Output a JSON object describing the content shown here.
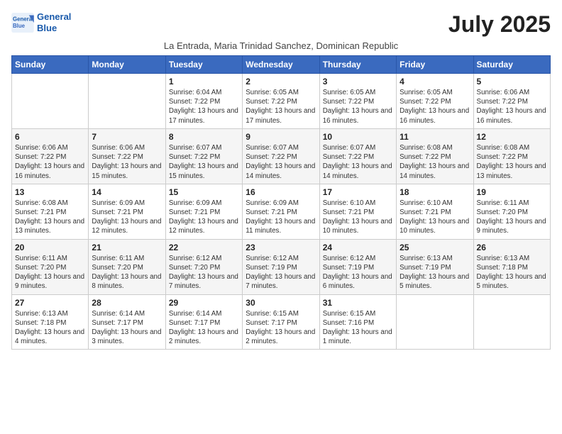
{
  "header": {
    "logo_line1": "General",
    "logo_line2": "Blue",
    "month_year": "July 2025",
    "location": "La Entrada, Maria Trinidad Sanchez, Dominican Republic"
  },
  "weekdays": [
    "Sunday",
    "Monday",
    "Tuesday",
    "Wednesday",
    "Thursday",
    "Friday",
    "Saturday"
  ],
  "weeks": [
    [
      {
        "day": "",
        "info": ""
      },
      {
        "day": "",
        "info": ""
      },
      {
        "day": "1",
        "info": "Sunrise: 6:04 AM\nSunset: 7:22 PM\nDaylight: 13 hours and 17 minutes."
      },
      {
        "day": "2",
        "info": "Sunrise: 6:05 AM\nSunset: 7:22 PM\nDaylight: 13 hours and 17 minutes."
      },
      {
        "day": "3",
        "info": "Sunrise: 6:05 AM\nSunset: 7:22 PM\nDaylight: 13 hours and 16 minutes."
      },
      {
        "day": "4",
        "info": "Sunrise: 6:05 AM\nSunset: 7:22 PM\nDaylight: 13 hours and 16 minutes."
      },
      {
        "day": "5",
        "info": "Sunrise: 6:06 AM\nSunset: 7:22 PM\nDaylight: 13 hours and 16 minutes."
      }
    ],
    [
      {
        "day": "6",
        "info": "Sunrise: 6:06 AM\nSunset: 7:22 PM\nDaylight: 13 hours and 16 minutes."
      },
      {
        "day": "7",
        "info": "Sunrise: 6:06 AM\nSunset: 7:22 PM\nDaylight: 13 hours and 15 minutes."
      },
      {
        "day": "8",
        "info": "Sunrise: 6:07 AM\nSunset: 7:22 PM\nDaylight: 13 hours and 15 minutes."
      },
      {
        "day": "9",
        "info": "Sunrise: 6:07 AM\nSunset: 7:22 PM\nDaylight: 13 hours and 14 minutes."
      },
      {
        "day": "10",
        "info": "Sunrise: 6:07 AM\nSunset: 7:22 PM\nDaylight: 13 hours and 14 minutes."
      },
      {
        "day": "11",
        "info": "Sunrise: 6:08 AM\nSunset: 7:22 PM\nDaylight: 13 hours and 14 minutes."
      },
      {
        "day": "12",
        "info": "Sunrise: 6:08 AM\nSunset: 7:22 PM\nDaylight: 13 hours and 13 minutes."
      }
    ],
    [
      {
        "day": "13",
        "info": "Sunrise: 6:08 AM\nSunset: 7:21 PM\nDaylight: 13 hours and 13 minutes."
      },
      {
        "day": "14",
        "info": "Sunrise: 6:09 AM\nSunset: 7:21 PM\nDaylight: 13 hours and 12 minutes."
      },
      {
        "day": "15",
        "info": "Sunrise: 6:09 AM\nSunset: 7:21 PM\nDaylight: 13 hours and 12 minutes."
      },
      {
        "day": "16",
        "info": "Sunrise: 6:09 AM\nSunset: 7:21 PM\nDaylight: 13 hours and 11 minutes."
      },
      {
        "day": "17",
        "info": "Sunrise: 6:10 AM\nSunset: 7:21 PM\nDaylight: 13 hours and 10 minutes."
      },
      {
        "day": "18",
        "info": "Sunrise: 6:10 AM\nSunset: 7:21 PM\nDaylight: 13 hours and 10 minutes."
      },
      {
        "day": "19",
        "info": "Sunrise: 6:11 AM\nSunset: 7:20 PM\nDaylight: 13 hours and 9 minutes."
      }
    ],
    [
      {
        "day": "20",
        "info": "Sunrise: 6:11 AM\nSunset: 7:20 PM\nDaylight: 13 hours and 9 minutes."
      },
      {
        "day": "21",
        "info": "Sunrise: 6:11 AM\nSunset: 7:20 PM\nDaylight: 13 hours and 8 minutes."
      },
      {
        "day": "22",
        "info": "Sunrise: 6:12 AM\nSunset: 7:20 PM\nDaylight: 13 hours and 7 minutes."
      },
      {
        "day": "23",
        "info": "Sunrise: 6:12 AM\nSunset: 7:19 PM\nDaylight: 13 hours and 7 minutes."
      },
      {
        "day": "24",
        "info": "Sunrise: 6:12 AM\nSunset: 7:19 PM\nDaylight: 13 hours and 6 minutes."
      },
      {
        "day": "25",
        "info": "Sunrise: 6:13 AM\nSunset: 7:19 PM\nDaylight: 13 hours and 5 minutes."
      },
      {
        "day": "26",
        "info": "Sunrise: 6:13 AM\nSunset: 7:18 PM\nDaylight: 13 hours and 5 minutes."
      }
    ],
    [
      {
        "day": "27",
        "info": "Sunrise: 6:13 AM\nSunset: 7:18 PM\nDaylight: 13 hours and 4 minutes."
      },
      {
        "day": "28",
        "info": "Sunrise: 6:14 AM\nSunset: 7:17 PM\nDaylight: 13 hours and 3 minutes."
      },
      {
        "day": "29",
        "info": "Sunrise: 6:14 AM\nSunset: 7:17 PM\nDaylight: 13 hours and 2 minutes."
      },
      {
        "day": "30",
        "info": "Sunrise: 6:15 AM\nSunset: 7:17 PM\nDaylight: 13 hours and 2 minutes."
      },
      {
        "day": "31",
        "info": "Sunrise: 6:15 AM\nSunset: 7:16 PM\nDaylight: 13 hours and 1 minute."
      },
      {
        "day": "",
        "info": ""
      },
      {
        "day": "",
        "info": ""
      }
    ]
  ]
}
